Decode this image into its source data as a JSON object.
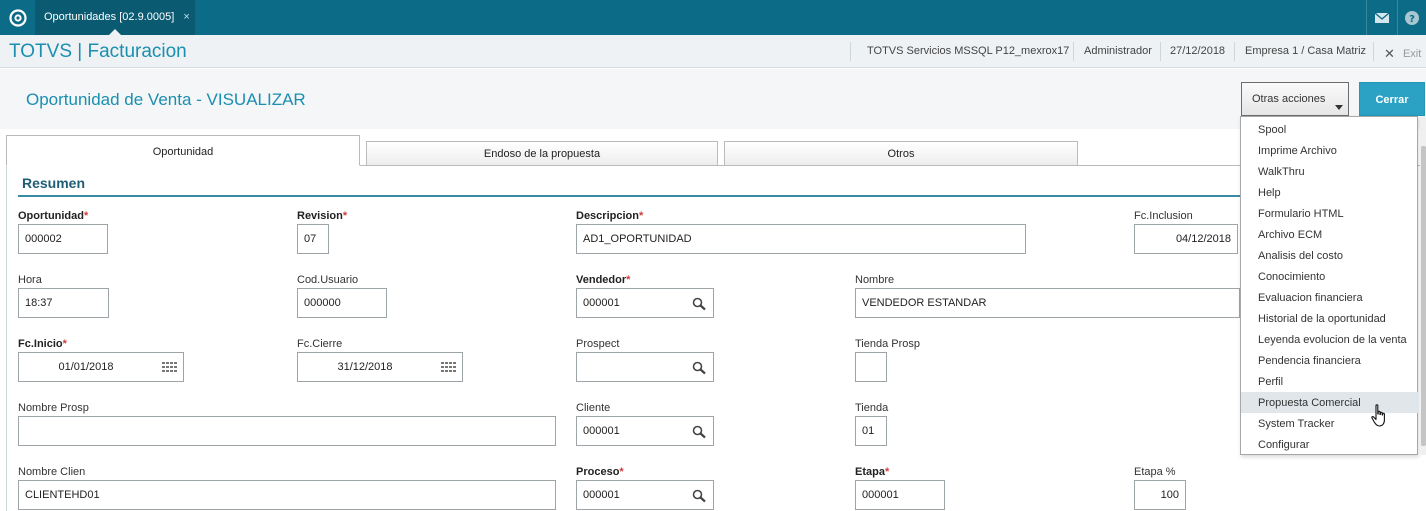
{
  "topbar": {
    "tab_label": "Oportunidades [02.9.0005]",
    "tab_close": "×"
  },
  "appbar": {
    "title": "TOTVS | Facturacion",
    "environment": "TOTVS Servicios MSSQL P12_mexrox17",
    "user": "Administrador",
    "date": "27/12/2018",
    "company": "Empresa 1 / Casa Matriz",
    "exit_label": "Exit"
  },
  "page": {
    "title": "Oportunidad de Venta - VISUALIZAR",
    "otras_label": "Otras acciones",
    "cerrar_label": "Cerrar"
  },
  "tabs": [
    "Oportunidad",
    "Endoso de la propuesta",
    "Otros"
  ],
  "section": {
    "title": "Resumen"
  },
  "fields": {
    "oportunidad": {
      "label": "Oportunidad",
      "value": "000002"
    },
    "revision": {
      "label": "Revision",
      "value": "07"
    },
    "descripcion": {
      "label": "Descripcion",
      "value": "AD1_OPORTUNIDAD"
    },
    "fc_inclusion": {
      "label": "Fc.Inclusion",
      "value": "04/12/2018"
    },
    "hora": {
      "label": "Hora",
      "value": "18:37"
    },
    "cod_usuario": {
      "label": "Cod.Usuario",
      "value": "000000"
    },
    "vendedor": {
      "label": "Vendedor",
      "value": "000001"
    },
    "nombre": {
      "label": "Nombre",
      "value": "VENDEDOR ESTANDAR"
    },
    "fc_inicio": {
      "label": "Fc.Inicio",
      "value": "01/01/2018"
    },
    "fc_cierre": {
      "label": "Fc.Cierre",
      "value": "31/12/2018"
    },
    "prospect": {
      "label": "Prospect",
      "value": ""
    },
    "tienda_prosp": {
      "label": "Tienda Prosp",
      "value": ""
    },
    "nombre_prosp": {
      "label": "Nombre Prosp",
      "value": ""
    },
    "cliente": {
      "label": "Cliente",
      "value": "000001"
    },
    "tienda": {
      "label": "Tienda",
      "value": "01"
    },
    "nombre_clien": {
      "label": "Nombre Clien",
      "value": "CLIENTEHD01"
    },
    "proceso": {
      "label": "Proceso",
      "value": "000001"
    },
    "etapa": {
      "label": "Etapa",
      "value": "000001"
    },
    "etapa_pct": {
      "label": "Etapa %",
      "value": "100"
    }
  },
  "required_mark": "*",
  "menu": {
    "items": [
      "Spool",
      "Imprime Archivo",
      "WalkThru",
      "Help",
      "Formulario HTML",
      "Archivo ECM",
      "Analisis del costo",
      "Conocimiento",
      "Evaluacion financiera",
      "Historial de la oportunidad",
      "Leyenda evolucion de la venta",
      "Pendencia financiera",
      "Perfil",
      "Propuesta Comercial",
      "System Tracker",
      "Configurar"
    ],
    "hovered_index": 13
  },
  "colors": {
    "topbar": "#0c6b86",
    "accent": "#1a8fb0",
    "primary_button": "#2ba2c4",
    "required": "#d23b3b"
  }
}
